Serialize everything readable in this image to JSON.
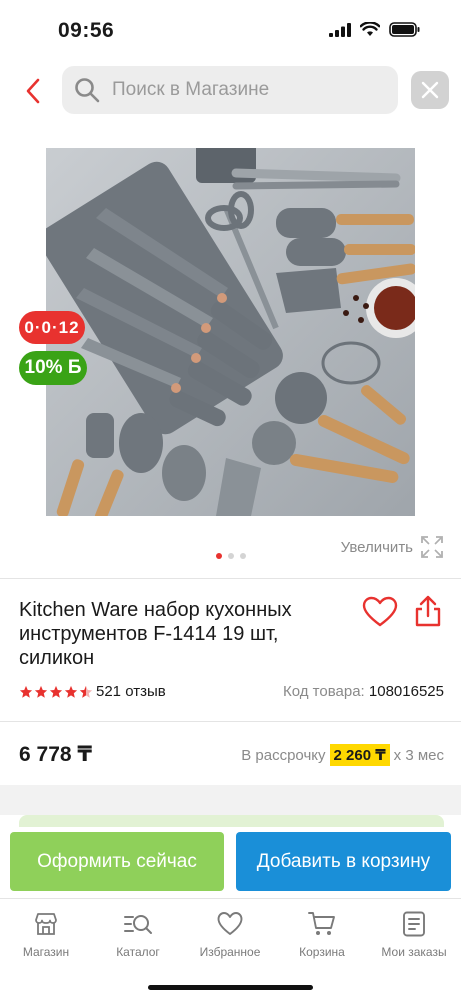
{
  "status": {
    "time": "09:56"
  },
  "search": {
    "placeholder": "Поиск в Магазине"
  },
  "product": {
    "badges": {
      "installment": "0·0·12",
      "bonus": "10% Б"
    },
    "zoom_label": "Увеличить",
    "title": "Kitchen Ware набор кухонных инструментов F-1414 19 шт, силикон",
    "rating": 4.5,
    "reviews": "521 отзыв",
    "sku_label": "Код товара:",
    "sku_value": "108016525",
    "price": "6 778 ₸",
    "installment_prefix": "В рассрочку",
    "installment_amount": "2 260 ₸",
    "installment_suffix": "х 3 мес"
  },
  "carousel": {
    "count": 3,
    "active": 0
  },
  "actions": {
    "buy_now": "Оформить сейчас",
    "add_to_cart": "Добавить в корзину"
  },
  "tabs": [
    {
      "label": "Магазин",
      "icon": "shop-icon"
    },
    {
      "label": "Каталог",
      "icon": "catalog-icon"
    },
    {
      "label": "Избранное",
      "icon": "heart-icon"
    },
    {
      "label": "Корзина",
      "icon": "cart-icon"
    },
    {
      "label": "Мои заказы",
      "icon": "orders-icon"
    }
  ],
  "colors": {
    "accent_red": "#e8322f",
    "bonus_green": "#3aa316",
    "buy_green": "#8fd05a",
    "cart_blue": "#1a8fd8",
    "installment_yellow": "#ffd800"
  }
}
